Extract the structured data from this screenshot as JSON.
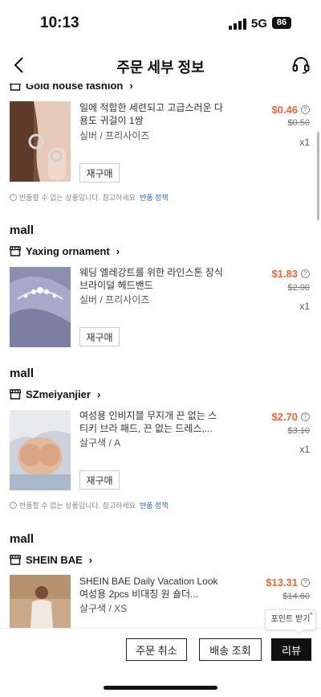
{
  "status_bar": {
    "time": "10:13",
    "network": "5G",
    "battery": "86"
  },
  "header": {
    "title": "주문 세부 정보"
  },
  "sections": [
    {
      "store": "Gold house fashion",
      "product": {
        "title": "일에 적합한 세련되고 고급스러운 다용도 귀걸이 1쌍",
        "variant": "실버 / 프리사이즈",
        "price": "$0.46",
        "original_price": "$0.50",
        "qty": "x1",
        "rebuy": "재구매"
      },
      "notice": {
        "text": "반품할 수 없는 상품입니다. 참고하세요",
        "link": "반품 정책"
      }
    },
    {
      "mall": "mall",
      "store": "Yaxing ornament",
      "product": {
        "title": "웨딩 엘레강트를 위한 라인스톤 장식 브라이덜 헤드밴드",
        "variant": "실버 / 프리사이즈",
        "price": "$1.83",
        "original_price": "$2.00",
        "qty": "x1",
        "rebuy": "재구매"
      }
    },
    {
      "mall": "mall",
      "store": "SZmeiyanjier",
      "product": {
        "title": "여성용 인비지블 무지개 끈 없는 스티키 브라 패드, 끈 없는 드레스,...",
        "variant": "살구색 / A",
        "price": "$2.70",
        "original_price": "$3.10",
        "qty": "x1",
        "rebuy": "재구매"
      },
      "notice": {
        "text": "반품할 수 없는 상품입니다. 참고하세요",
        "link": "반품 정책"
      }
    },
    {
      "mall": "mall",
      "store": "SHEIN BAE",
      "product": {
        "title": "SHEIN BAE Daily Vacation Look 여성용 2pcs 비대칭 원 숄더...",
        "variant": "살구색 / XS",
        "price": "$13.31",
        "original_price": "$14.60"
      }
    }
  ],
  "tooltip": {
    "text": "포인트 받기",
    "close": "×"
  },
  "bottom_bar": {
    "cancel": "주문 취소",
    "track": "배송 조회",
    "review": "리뷰"
  },
  "colors": {
    "price": "#f0652f",
    "link": "#2f6bd1",
    "primary_button": "#111111"
  },
  "icons": [
    "back-arrow-icon",
    "headset-icon",
    "store-icon",
    "chevron-right-icon",
    "info-icon",
    "close-icon"
  ]
}
